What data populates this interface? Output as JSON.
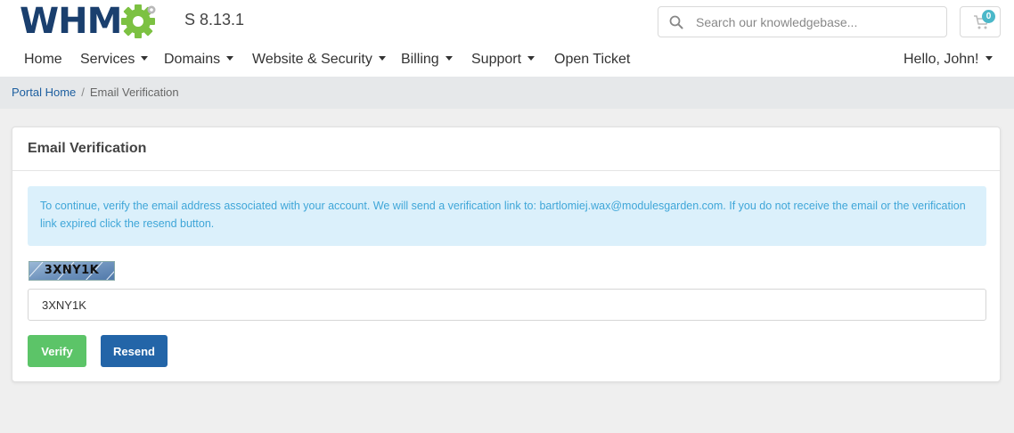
{
  "brand": {
    "logo_text_left": "WHM",
    "logo_text_right": "S",
    "version_text": "S 8.13.1",
    "colors": {
      "logo_blue": "#1a3f6e",
      "gear_green": "#7cc142"
    }
  },
  "search": {
    "placeholder": "Search our knowledgebase...",
    "value": "",
    "icon": "search-icon"
  },
  "cart": {
    "icon": "cart-icon",
    "count": "0"
  },
  "nav": {
    "items": [
      {
        "label": "Home",
        "dropdown": false
      },
      {
        "label": "Services",
        "dropdown": true
      },
      {
        "label": "Domains",
        "dropdown": true
      },
      {
        "label": "Website & Security",
        "dropdown": true
      },
      {
        "label": "Billing",
        "dropdown": true
      },
      {
        "label": "Support",
        "dropdown": true
      },
      {
        "label": "Open Ticket",
        "dropdown": false
      }
    ],
    "account": {
      "label": "Hello, John!",
      "dropdown": true
    }
  },
  "breadcrumb": {
    "home": "Portal Home",
    "separator": "/",
    "current": "Email Verification"
  },
  "card": {
    "title": "Email Verification",
    "alert_text": "To continue, verify the email address associated with your account. We will send a verification link to: bartlomiej.wax@modulesgarden.com. If you do not receive the email or the verification link expired click the resend button.",
    "captcha_image_text": "3XNY1K",
    "captcha_input_value": "3XNY1K",
    "buttons": {
      "verify": "Verify",
      "resend": "Resend"
    }
  },
  "colors": {
    "page_bg": "#efefef",
    "breadcrumb_bg": "#e6e8ea",
    "alert_bg": "#dbf0fb",
    "alert_text": "#3fa6d8",
    "verify_green": "#5cc468",
    "resend_blue": "#2365a8",
    "link_blue": "#1d5fa0",
    "badge_teal": "#4bb8c9"
  }
}
